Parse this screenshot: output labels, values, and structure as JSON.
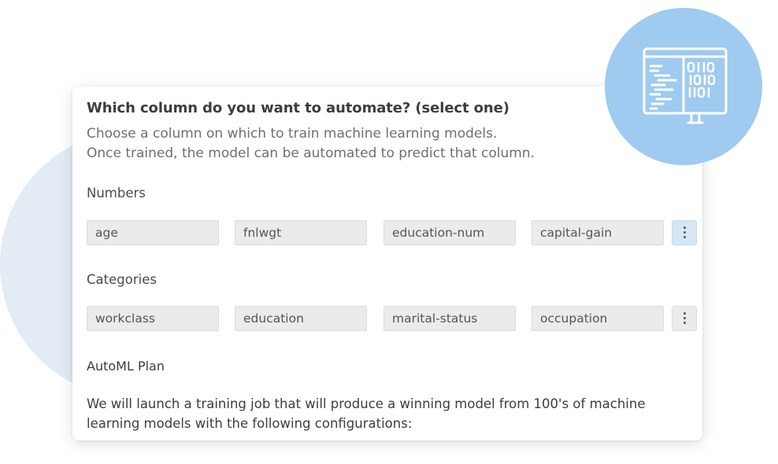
{
  "dialog": {
    "title": "Which column do you want to automate? (select one)",
    "subtitle_line1": "Choose a column on which to train machine learning models.",
    "subtitle_line2": "Once trained, the model can be automated to predict that column."
  },
  "numbers": {
    "label": "Numbers",
    "columns": [
      "age",
      "fnlwgt",
      "education-num",
      "capital-gain"
    ]
  },
  "categories": {
    "label": "Categories",
    "columns": [
      "workclass",
      "education",
      "marital-status",
      "occupation"
    ]
  },
  "automl_plan": {
    "label": "AutoML Plan",
    "description": "We will launch a training job that will produce a winning model from 100's of machine learning models with the following configurations:"
  },
  "badge": {
    "icon": "binary-code-monitor-icon",
    "circle_color": "#9ecbef"
  },
  "colors": {
    "background_circle": "#e3ebf5",
    "more_button_active": "#d6e6f4"
  }
}
